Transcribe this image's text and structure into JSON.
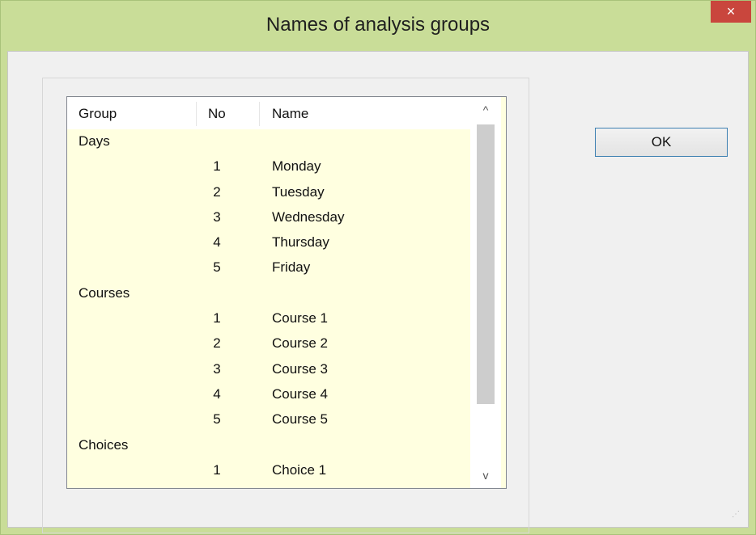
{
  "window": {
    "title": "Names of analysis groups",
    "close_glyph": "×"
  },
  "list": {
    "columns": [
      "Group",
      "No",
      "Name"
    ],
    "rows": [
      {
        "group": "Days",
        "no": "",
        "name": ""
      },
      {
        "group": "",
        "no": "1",
        "name": "Monday"
      },
      {
        "group": "",
        "no": "2",
        "name": "Tuesday"
      },
      {
        "group": "",
        "no": "3",
        "name": "Wednesday"
      },
      {
        "group": "",
        "no": "4",
        "name": "Thursday"
      },
      {
        "group": "",
        "no": "5",
        "name": "Friday"
      },
      {
        "group": "Courses",
        "no": "",
        "name": ""
      },
      {
        "group": "",
        "no": "1",
        "name": "Course 1"
      },
      {
        "group": "",
        "no": "2",
        "name": "Course 2"
      },
      {
        "group": "",
        "no": "3",
        "name": "Course 3"
      },
      {
        "group": "",
        "no": "4",
        "name": "Course 4"
      },
      {
        "group": "",
        "no": "5",
        "name": "Course 5"
      },
      {
        "group": "Choices",
        "no": "",
        "name": ""
      },
      {
        "group": "",
        "no": "1",
        "name": "Choice 1"
      }
    ],
    "scroll_up_glyph": "^",
    "scroll_down_glyph": "v"
  },
  "buttons": {
    "ok_label": "OK"
  },
  "icons": [
    "close-icon",
    "scroll-up-icon",
    "scroll-down-icon",
    "resize-grip-icon"
  ],
  "colors": {
    "title_bar": "#c9dd98",
    "list_background": "#ffffe0",
    "close_button": "#c9463d"
  }
}
